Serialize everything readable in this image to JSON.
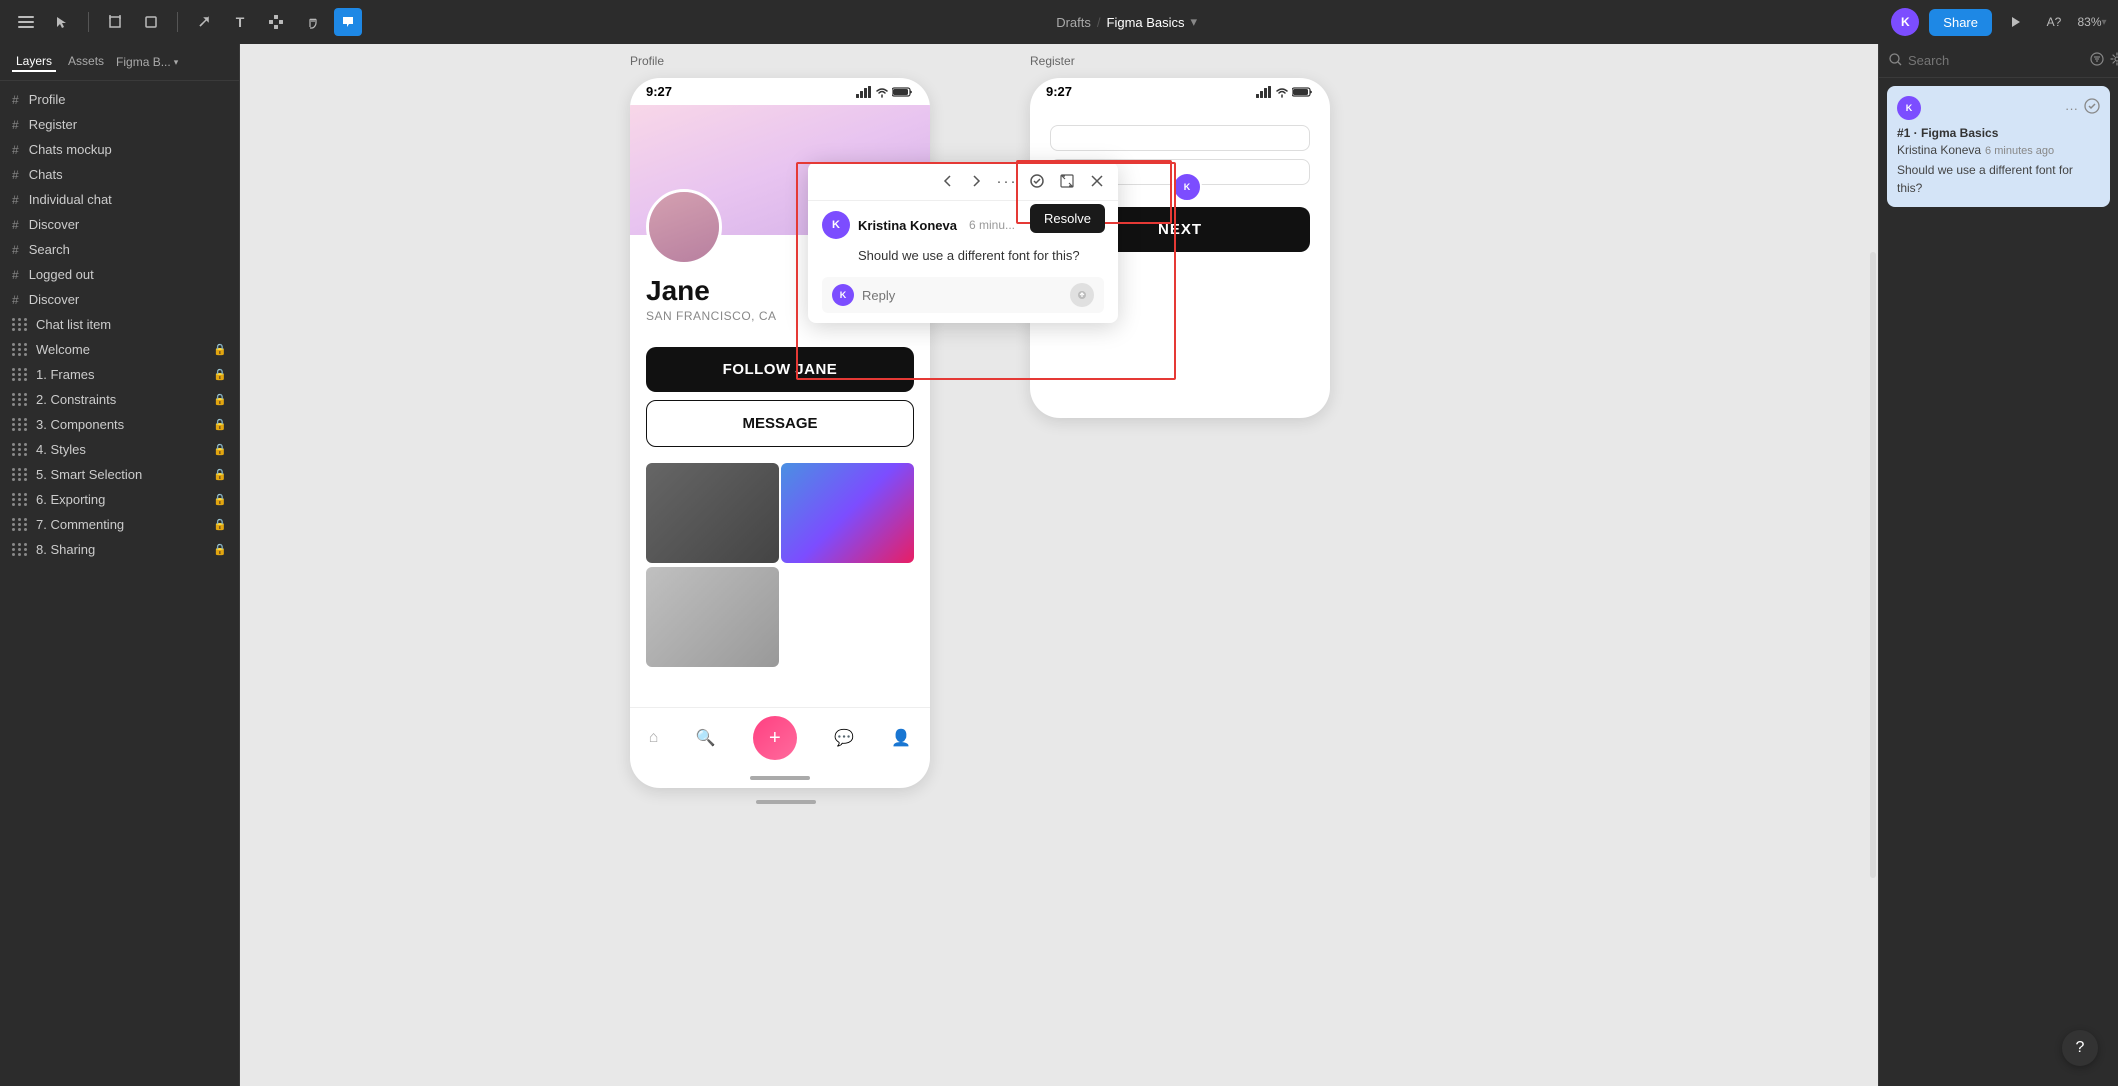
{
  "toolbar": {
    "title": "Drafts",
    "slash": "/",
    "project": "Figma Basics",
    "share_label": "Share",
    "zoom": "83%",
    "avatar_initial": "K"
  },
  "sidebar": {
    "tabs": [
      "Layers",
      "Assets",
      "Figma B..."
    ],
    "items": [
      {
        "label": "Profile",
        "type": "frame",
        "icon": "#"
      },
      {
        "label": "Register",
        "type": "frame",
        "icon": "#"
      },
      {
        "label": "Chats mockup",
        "type": "frame",
        "icon": "#"
      },
      {
        "label": "Chats",
        "type": "frame",
        "icon": "#"
      },
      {
        "label": "Individual chat",
        "type": "frame",
        "icon": "#"
      },
      {
        "label": "Discover",
        "type": "frame",
        "icon": "#"
      },
      {
        "label": "Search",
        "type": "frame",
        "icon": "#"
      },
      {
        "label": "Logged out",
        "type": "frame",
        "icon": "#"
      },
      {
        "label": "Discover",
        "type": "frame",
        "icon": "#"
      },
      {
        "label": "Chat list item",
        "type": "component",
        "icon": "⠿"
      },
      {
        "label": "Welcome",
        "type": "page",
        "icon": "⠿",
        "locked": true
      },
      {
        "label": "1. Frames",
        "type": "page",
        "icon": "⠿",
        "locked": true
      },
      {
        "label": "2. Constraints",
        "type": "page",
        "icon": "⠿",
        "locked": true
      },
      {
        "label": "3. Components",
        "type": "page",
        "icon": "⠿",
        "locked": true
      },
      {
        "label": "4. Styles",
        "type": "page",
        "icon": "⠿",
        "locked": true
      },
      {
        "label": "5. Smart Selection",
        "type": "page",
        "icon": "⠿",
        "locked": true
      },
      {
        "label": "6. Exporting",
        "type": "page",
        "icon": "⠿",
        "locked": true
      },
      {
        "label": "7. Commenting",
        "type": "page",
        "icon": "⠿",
        "locked": true
      },
      {
        "label": "8. Sharing",
        "type": "page",
        "icon": "⠿",
        "locked": true
      }
    ]
  },
  "canvas": {
    "frame_labels": [
      "Profile",
      "Register"
    ],
    "phone_status_time": "9:27",
    "phone_status_time2": "9:27"
  },
  "comment": {
    "user_initial": "K",
    "user_name": "Kristina Koneva",
    "time": "6 minu...",
    "text": "Should we use a different font for this?",
    "reply_placeholder": "Reply",
    "resolve_label": "Resolve"
  },
  "right_panel": {
    "search_placeholder": "Search",
    "thread": {
      "initial": "K",
      "number": "#1 · Figma Basics",
      "user": "Kristina Koneva",
      "time": "6 minutes ago",
      "text": "Should we use a different font for this?"
    }
  },
  "profile": {
    "name": "Jane",
    "location": "SAN FRANCISCO, CA",
    "follow_label": "FOLLOW JANE",
    "message_label": "MESSAGE"
  },
  "register": {
    "next_label": "NEXT"
  },
  "help": "?"
}
